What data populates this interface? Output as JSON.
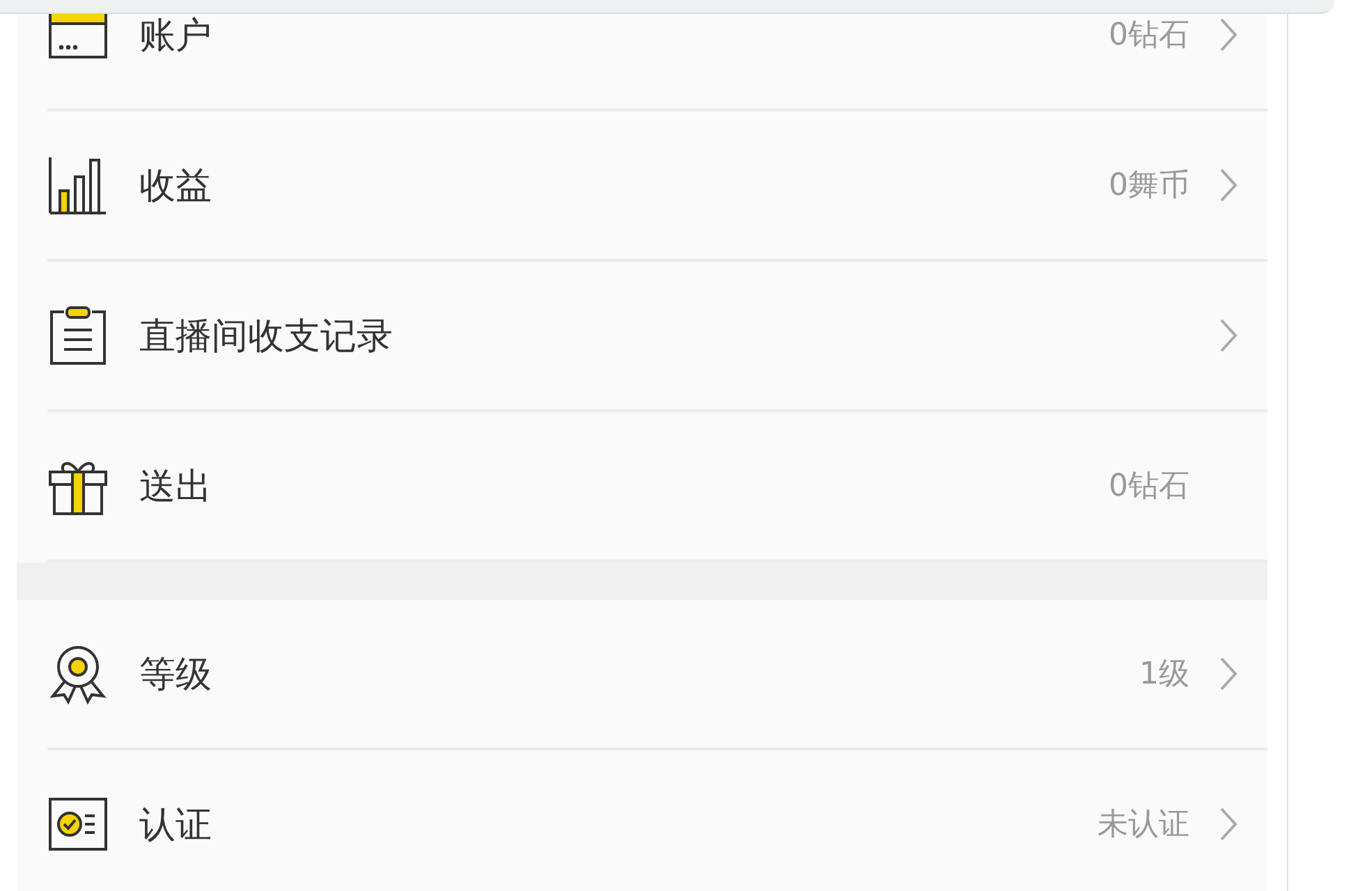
{
  "groups": [
    {
      "rows": [
        {
          "kind": "wallet",
          "label": "账户",
          "value": "0钻石",
          "arrow": true
        },
        {
          "kind": "chart",
          "label": "收益",
          "value": "0舞币",
          "arrow": true
        },
        {
          "kind": "clipboard",
          "label": "直播间收支记录",
          "arrow": true
        },
        {
          "kind": "gift",
          "label": "送出",
          "value": "0钻石",
          "arrow": false
        }
      ]
    },
    {
      "rows": [
        {
          "kind": "medal",
          "label": "等级",
          "value": "1级",
          "arrow": true
        },
        {
          "kind": "certificate",
          "label": "认证",
          "value": "未认证",
          "arrow": true
        }
      ]
    }
  ]
}
